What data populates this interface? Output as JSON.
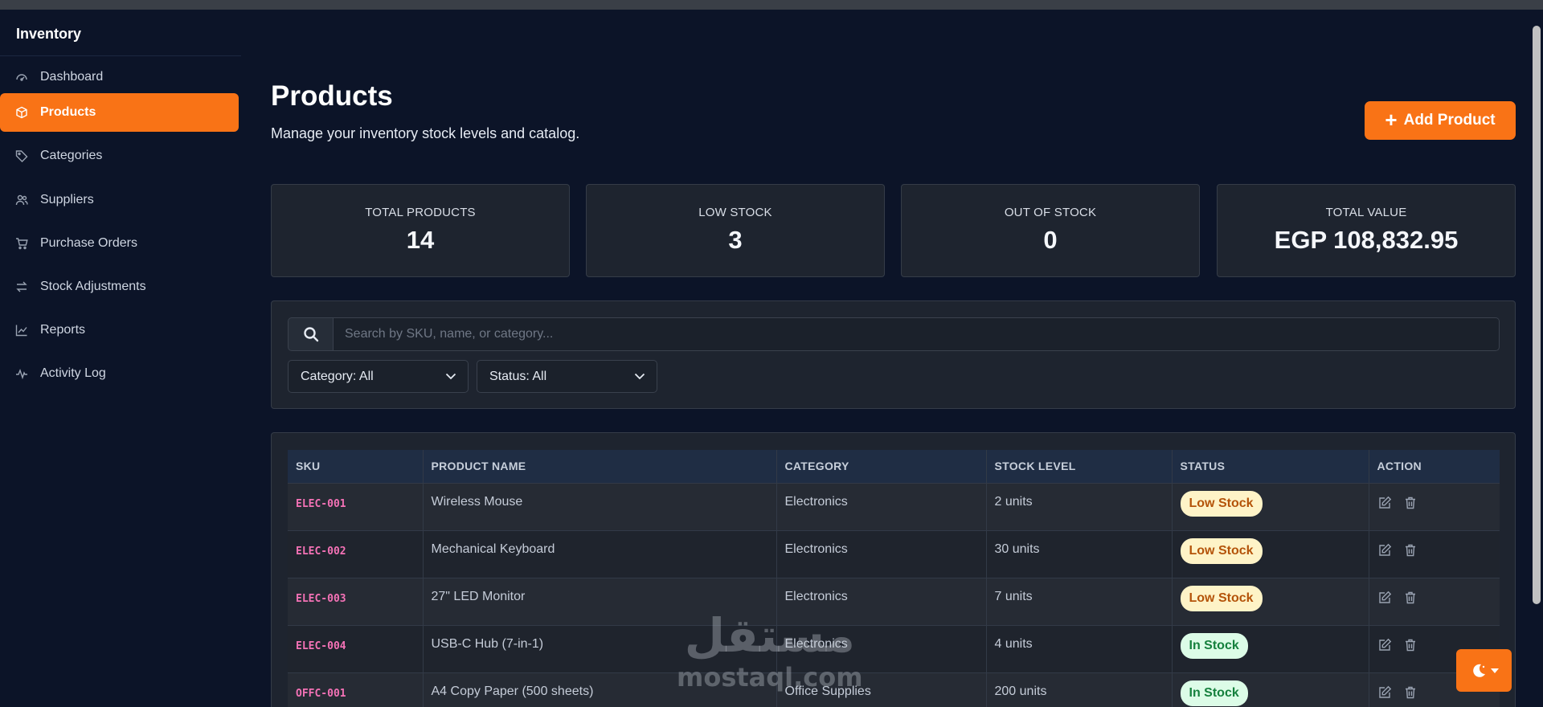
{
  "app": {
    "brand": "Inventory"
  },
  "sidebar": {
    "items": [
      {
        "label": "Dashboard",
        "icon": "dashboard-icon"
      },
      {
        "label": "Products",
        "icon": "box-icon",
        "active": true
      },
      {
        "label": "Categories",
        "icon": "tag-icon"
      },
      {
        "label": "Suppliers",
        "icon": "users-icon"
      },
      {
        "label": "Purchase Orders",
        "icon": "cart-icon"
      },
      {
        "label": "Stock Adjustments",
        "icon": "arrows-icon"
      },
      {
        "label": "Reports",
        "icon": "chart-icon"
      },
      {
        "label": "Activity Log",
        "icon": "pulse-icon"
      }
    ]
  },
  "header": {
    "title": "Products",
    "subtitle": "Manage your inventory stock levels and catalog.",
    "add_button": "Add Product"
  },
  "stats": [
    {
      "label": "TOTAL PRODUCTS",
      "value": "14"
    },
    {
      "label": "LOW STOCK",
      "value": "3"
    },
    {
      "label": "OUT OF STOCK",
      "value": "0"
    },
    {
      "label": "TOTAL VALUE",
      "value": "EGP 108,832.95"
    }
  ],
  "filters": {
    "search_placeholder": "Search by SKU, name, or category...",
    "category": "Category: All",
    "status": "Status: All"
  },
  "table": {
    "columns": [
      "SKU",
      "PRODUCT NAME",
      "CATEGORY",
      "STOCK LEVEL",
      "STATUS",
      "ACTION"
    ],
    "rows": [
      {
        "sku": "ELEC-001",
        "name": "Wireless Mouse",
        "category": "Electronics",
        "stock": "2 units",
        "status": "Low Stock"
      },
      {
        "sku": "ELEC-002",
        "name": "Mechanical Keyboard",
        "category": "Electronics",
        "stock": "30 units",
        "status": "Low Stock"
      },
      {
        "sku": "ELEC-003",
        "name": "27\" LED Monitor",
        "category": "Electronics",
        "stock": "7 units",
        "status": "Low Stock"
      },
      {
        "sku": "ELEC-004",
        "name": "USB-C Hub (7-in-1)",
        "category": "Electronics",
        "stock": "4 units",
        "status": "In Stock"
      },
      {
        "sku": "OFFC-001",
        "name": "A4 Copy Paper (500 sheets)",
        "category": "Office Supplies",
        "stock": "200 units",
        "status": "In Stock"
      }
    ]
  },
  "watermark": {
    "arabic": "مستقل",
    "latin": "mostaql.com"
  },
  "colors": {
    "accent": "#f97316",
    "background": "#0c1428",
    "card": "#1e242f",
    "sku": "#f472b6"
  }
}
